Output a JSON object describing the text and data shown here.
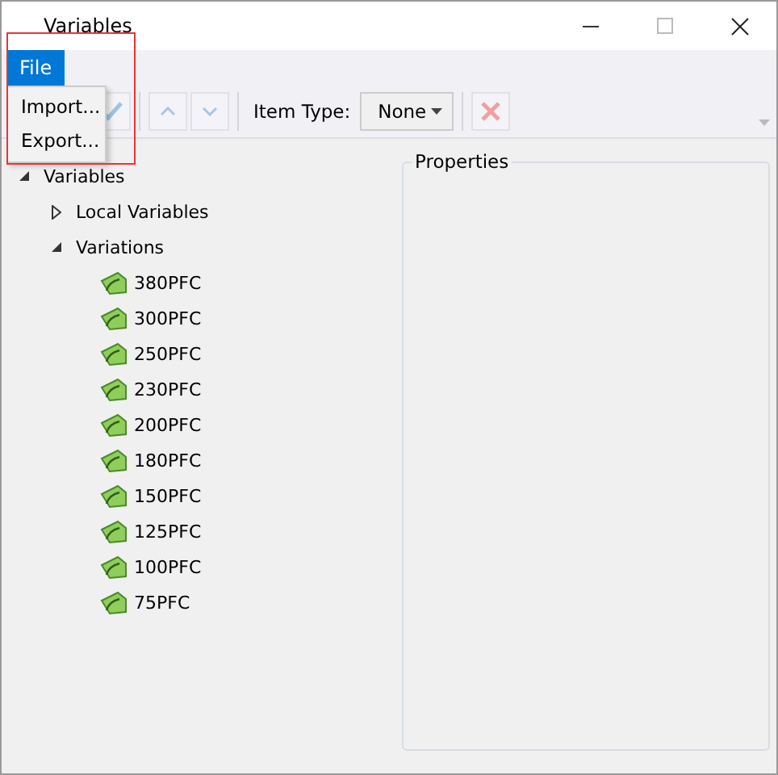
{
  "window": {
    "title": "Variables"
  },
  "menu": [
    {
      "label": "File",
      "selected": true
    }
  ],
  "file_menu": {
    "items": [
      "Import...",
      "Export..."
    ]
  },
  "toolbar": {
    "item_type_label": "Item Type:",
    "item_type_value": "None",
    "buttons": [
      {
        "kind": "check",
        "disabled": true
      },
      {
        "kind": "up",
        "disabled": true
      },
      {
        "kind": "down",
        "disabled": true
      },
      {
        "kind": "delete",
        "disabled": true
      }
    ]
  },
  "tree": [
    {
      "label": "Variables",
      "expanded": true,
      "children": [
        {
          "label": "Local Variables",
          "expanded": false
        },
        {
          "label": "Variations",
          "expanded": true,
          "children": [
            {
              "label": "380PFC"
            },
            {
              "label": "300PFC"
            },
            {
              "label": "250PFC"
            },
            {
              "label": "230PFC"
            },
            {
              "label": "200PFC"
            },
            {
              "label": "180PFC"
            },
            {
              "label": "150PFC"
            },
            {
              "label": "125PFC"
            },
            {
              "label": "100PFC"
            },
            {
              "label": "75PFC"
            }
          ]
        }
      ]
    }
  ],
  "properties": {
    "title": "Properties"
  }
}
